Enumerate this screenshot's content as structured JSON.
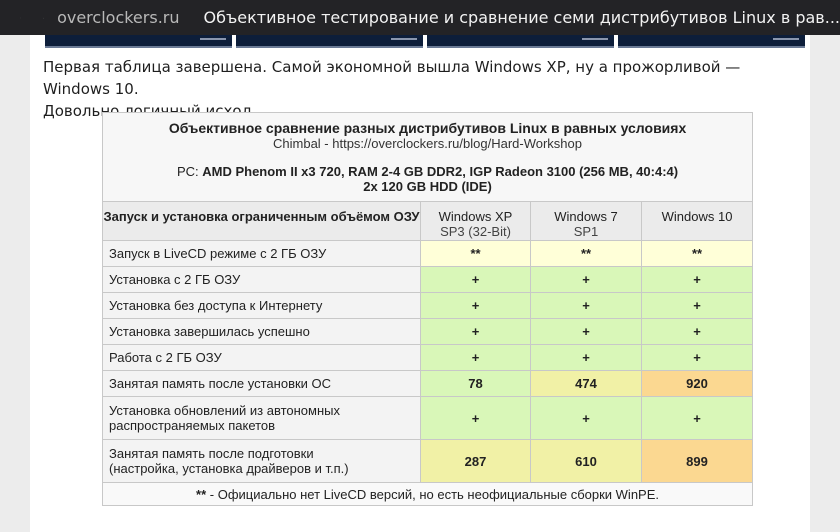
{
  "browser": {
    "domain": "overclockers.ru",
    "title": "Объективное тестирование и сравнение семи дистрибутивов Linux в рав..."
  },
  "article": {
    "paragraph_line1": "Первая таблица завершена. Самой экономной вышла Windows XP, ну а прожорливой — Windows 10.",
    "paragraph_line2": "Довольно логичный исход."
  },
  "table": {
    "title": "Объективное сравнение разных дистрибутивов Linux в равных условиях",
    "source": "Chimbal - https://overclockers.ru/blog/Hard-Workshop",
    "pc_label": "PC: ",
    "pc_specs": "AMD Phenom II x3 720, RAM 2-4 GB DDR2, IGP Radeon 3100 (256 MB, 40:4:4)",
    "pc_specs_line2": "2x 120 GB HDD (IDE)",
    "row_header": "Запуск и установка ограниченным объёмом ОЗУ",
    "columns": [
      {
        "name": "Windows XP",
        "sub": "SP3 (32-Bit)"
      },
      {
        "name": "Windows 7",
        "sub": "SP1"
      },
      {
        "name": "Windows 10",
        "sub": ""
      }
    ],
    "rows": [
      {
        "label": "Запуск в LiveCD режиме с 2 ГБ ОЗУ",
        "values": [
          "**",
          "**",
          "**"
        ]
      },
      {
        "label": "Установка с 2 ГБ ОЗУ",
        "values": [
          "+",
          "+",
          "+"
        ]
      },
      {
        "label": "Установка без доступа к Интернету",
        "values": [
          "+",
          "+",
          "+"
        ]
      },
      {
        "label": "Установка завершилась успешно",
        "values": [
          "+",
          "+",
          "+"
        ]
      },
      {
        "label": "Работа с 2 ГБ ОЗУ",
        "values": [
          "+",
          "+",
          "+"
        ]
      },
      {
        "label": "Занятая память после установки ОС",
        "values": [
          "78",
          "474",
          "920"
        ]
      },
      {
        "label_line1": "Установка обновлений из автономных",
        "label_line2": "распространяемых пакетов",
        "values": [
          "+",
          "+",
          "+"
        ]
      },
      {
        "label_line1": "Занятая память после подготовки",
        "label_line2": "(настройка, установка драйверов и т.п.)",
        "values": [
          "287",
          "610",
          "899"
        ]
      }
    ],
    "footnote_mark": "**",
    "footnote_text": " - Официально нет LiveCD версий, но есть неофициальные сборки WinPE."
  },
  "colors": {
    "yellow": "#ffffd8",
    "green": "#d9f7b8",
    "light_yellow": "#f1f1a6",
    "orange": "#fbd891"
  }
}
